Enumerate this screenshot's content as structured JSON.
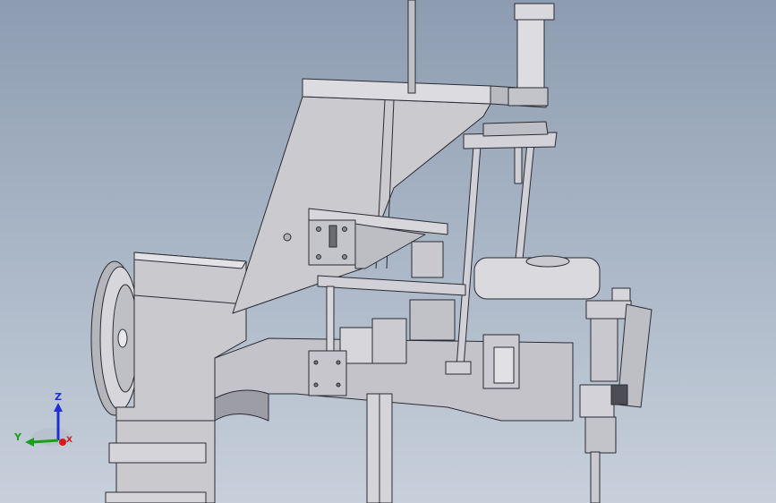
{
  "triad": {
    "axes": [
      {
        "label": "Z",
        "color": "#1f2fd6"
      },
      {
        "label": "Y",
        "color": "#1aa01a"
      },
      {
        "label": "X",
        "color": "#d41a1a"
      }
    ]
  },
  "colors": {
    "background_top": "#8d9cb1",
    "background_bottom": "#c7d0db",
    "part_fill": "#cfcfd4",
    "part_shade": "#a9a9b1",
    "edge": "#2b2b33"
  },
  "icons": {
    "orientation": "view-orientation-triad-icon"
  }
}
